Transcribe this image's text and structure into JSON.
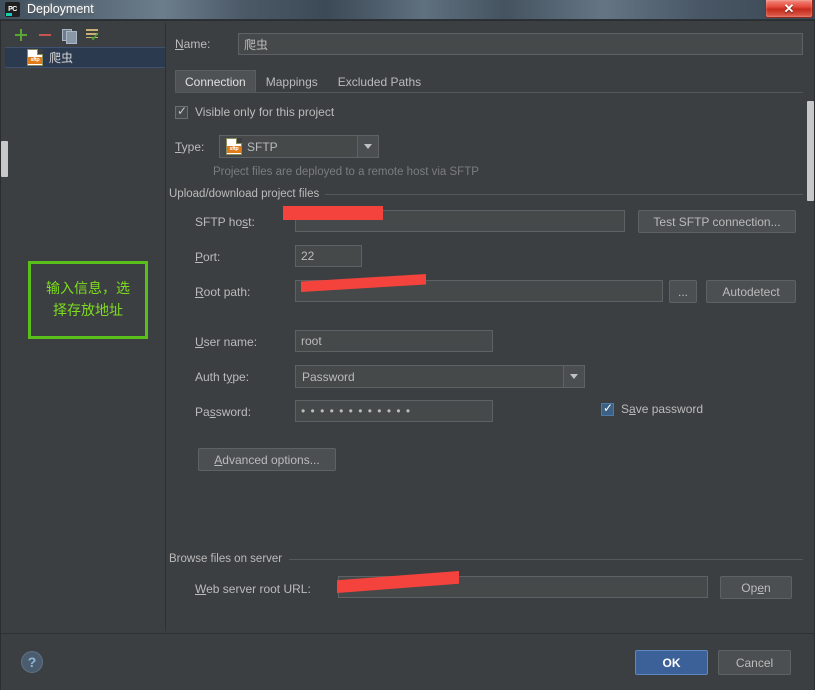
{
  "window": {
    "title": "Deployment",
    "app_icon": "pycharm-icon",
    "close_label": "✕"
  },
  "sidebar": {
    "toolbar": [
      {
        "name": "add-server-button",
        "icon": "plus-icon",
        "label": ""
      },
      {
        "name": "remove-server-button",
        "icon": "minus-icon",
        "label": ""
      },
      {
        "name": "copy-server-button",
        "icon": "copy-icon",
        "label": ""
      },
      {
        "name": "set-default-server-button",
        "icon": "checked-list-icon",
        "label": ""
      }
    ],
    "items": [
      {
        "label": "爬虫",
        "icon": "sftp-file-icon",
        "badge": "sftp",
        "selected": true
      }
    ]
  },
  "form": {
    "name_label": "Name:",
    "name_value": "爬虫",
    "tabs": [
      {
        "label": "Connection",
        "active": true
      },
      {
        "label": "Mappings",
        "active": false
      },
      {
        "label": "Excluded Paths",
        "active": false
      }
    ],
    "visible_only_label": "Visible only for this project",
    "visible_only_checked": true,
    "type_label": "Type:",
    "type_value": "SFTP",
    "type_icon": "sftp-file-icon",
    "type_hint": "Project files are deployed to a remote host via SFTP",
    "upload_group_title": "Upload/download project files",
    "sftp_host_label": "SFTP host:",
    "sftp_host_value": "",
    "test_connection_label": "Test SFTP connection...",
    "port_label": "Port:",
    "port_value": "22",
    "root_path_label": "Root path:",
    "root_path_value": "",
    "browse_button_label": "...",
    "autodetect_label": "Autodetect",
    "user_name_label": "User name:",
    "user_name_value": "root",
    "auth_type_label": "Auth type:",
    "auth_type_value": "Password",
    "password_label": "Password:",
    "password_value": "• • • • • • • • • • • •",
    "save_password_label": "Save password",
    "save_password_checked": true,
    "advanced_options_label": "Advanced options...",
    "browse_group_title": "Browse files on server",
    "web_root_label": "Web server root URL:",
    "web_root_value": "",
    "open_label": "Open"
  },
  "annotation": {
    "line1": "输入信息，选",
    "line2": "择存放地址",
    "color": "#7ddd1e"
  },
  "footer": {
    "help_label": "?",
    "ok_label": "OK",
    "cancel_label": "Cancel"
  },
  "colors": {
    "background": "#3c3f41",
    "field": "#45494a",
    "accent": "#3c6098",
    "redaction": "#f4433c",
    "annotation": "#5bbf1a"
  }
}
